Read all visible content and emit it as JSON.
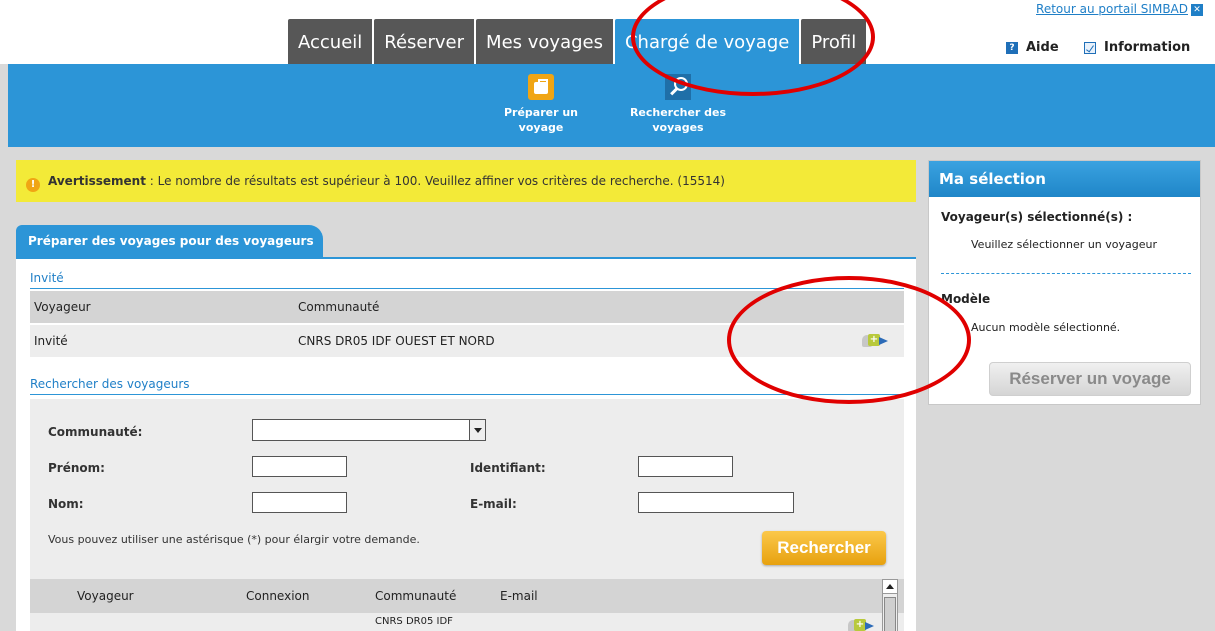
{
  "portal": {
    "return_label": "Retour au portail SIMBAD",
    "close_glyph": "✕"
  },
  "nav": {
    "tabs": [
      "Accueil",
      "Réserver",
      "Mes voyages",
      "Chargé de voyage",
      "Profil"
    ],
    "active_tab": "Chargé de voyage",
    "help_label": "Aide",
    "info_label": "Information"
  },
  "subnav": {
    "items": [
      {
        "label_line1": "Préparer un",
        "label_line2": "voyage",
        "icon": "briefcase-icon"
      },
      {
        "label_line1": "Rechercher des",
        "label_line2": "voyages",
        "icon": "search-icon"
      }
    ]
  },
  "warning": {
    "bold": "Avertissement",
    "text": " : Le nombre de résultats est supérieur à 100. Veuillez affiner vos critères de recherche. (15514)"
  },
  "main": {
    "tab_label": "Préparer des voyages pour des voyageurs",
    "invite_section": {
      "title": "Invité",
      "headers": [
        "Voyageur",
        "Communauté"
      ],
      "row": {
        "voyageur": "Invité",
        "communaute": "CNRS DR05 IDF OUEST ET NORD"
      }
    },
    "search_section": {
      "title": "Rechercher des voyageurs",
      "fields": {
        "communaute_label": "Communauté:",
        "communaute_value": "",
        "prenom_label": "Prénom:",
        "prenom_value": "",
        "identifiant_label": "Identifiant:",
        "identifiant_value": "",
        "nom_label": "Nom:",
        "nom_value": "",
        "email_label": "E-mail:",
        "email_value": ""
      },
      "hint": "Vous pouvez utiliser une astérisque (*) pour élargir votre demande.",
      "button": "Rechercher"
    },
    "results": {
      "headers": [
        "Voyageur",
        "Connexion",
        "Communauté",
        "E-mail"
      ],
      "first_row_communaute": "CNRS DR05 IDF"
    }
  },
  "selection": {
    "title": "Ma sélection",
    "voyageurs_label": "Voyageur(s) sélectionné(s) :",
    "voyageurs_text": "Veuillez sélectionner un voyageur",
    "modele_label": "Modèle",
    "modele_text": "Aucun modèle sélectionné.",
    "button": "Réserver un voyage"
  },
  "colors": {
    "brand_blue": "#2c95d7",
    "tab_grey": "#575757",
    "warning_yellow": "#f3ea38",
    "action_orange": "#e7a10f",
    "annotation_red": "#e00000"
  }
}
